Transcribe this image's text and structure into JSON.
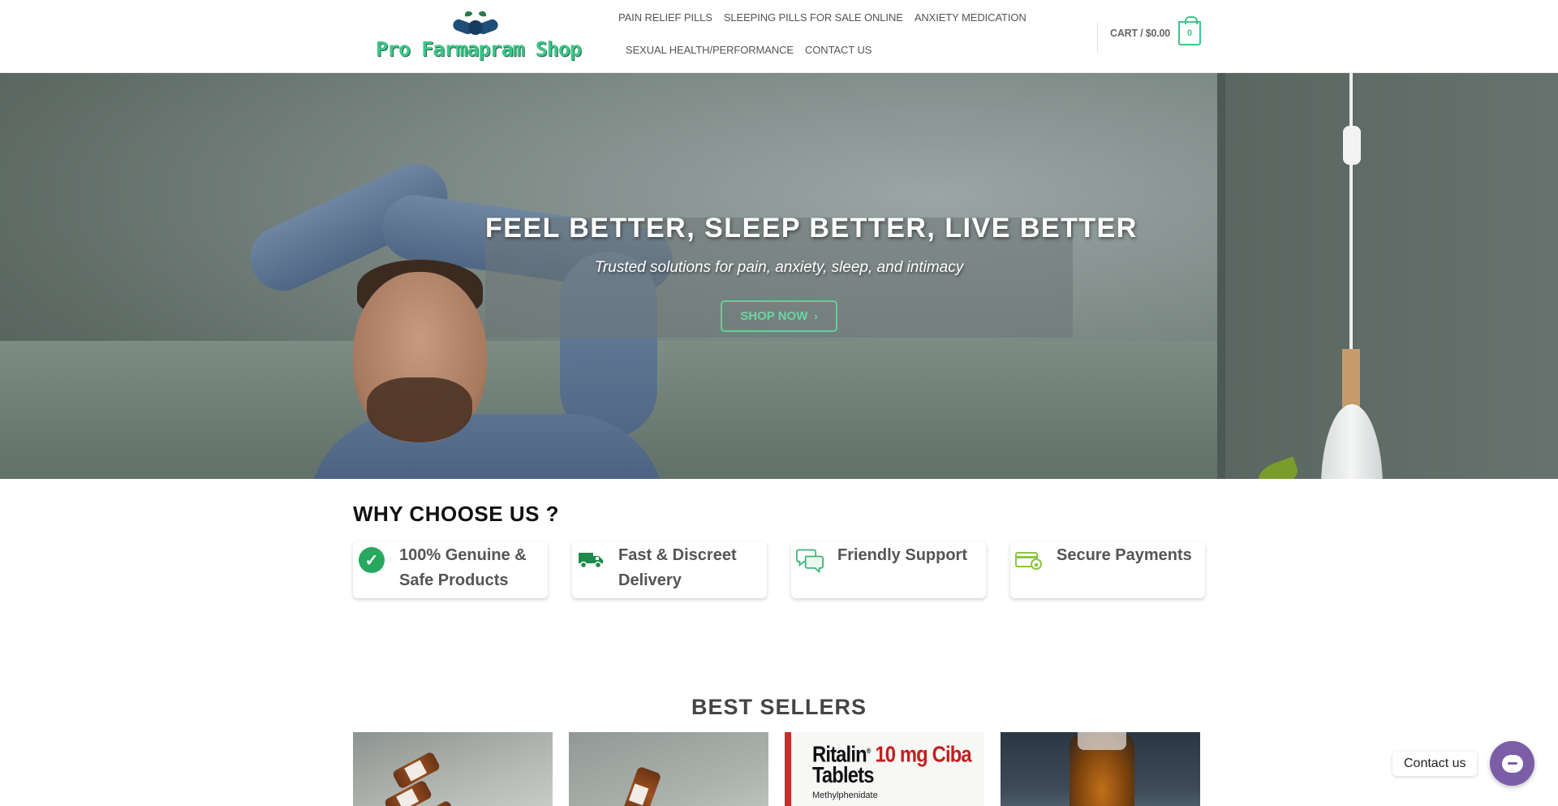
{
  "header": {
    "logo_text": "Pro Farmapram Shop",
    "nav_row1": [
      "PAIN RELIEF PILLS",
      "SLEEPING PILLS FOR SALE ONLINE",
      "ANXIETY MEDICATION"
    ],
    "nav_row2": [
      "SEXUAL HEALTH/PERFORMANCE",
      "CONTACT US"
    ],
    "cart_label": "CART / $0.00",
    "cart_count": "0"
  },
  "hero": {
    "title": "FEEL BETTER, SLEEP BETTER, LIVE BETTER",
    "subtitle": "Trusted solutions for pain, anxiety, sleep, and intimacy",
    "button_label": "SHOP NOW",
    "button_icon": "chevron-right-icon"
  },
  "why": {
    "title": "WHY CHOOSE US ?",
    "features": [
      {
        "label": "100% Genuine & Safe Products",
        "icon": "check-circle-icon"
      },
      {
        "label": "Fast & Discreet Delivery",
        "icon": "truck-icon"
      },
      {
        "label": "Friendly Support",
        "icon": "chat-bubbles-icon"
      },
      {
        "label": "Secure Payments",
        "icon": "credit-card-icon"
      }
    ]
  },
  "best_sellers": {
    "title": "BEST SELLERS",
    "ritalin_box": {
      "brand": "Ritalin",
      "strength": "10 mg",
      "maker": "Ciba",
      "form": "Tablets",
      "ingredient": "Methylphenidate"
    }
  },
  "contact_widget": {
    "label": "Contact us"
  },
  "colors": {
    "brand_green": "#3fc58a",
    "check_green": "#28a75f",
    "fab_purple": "#7b5ea7"
  }
}
